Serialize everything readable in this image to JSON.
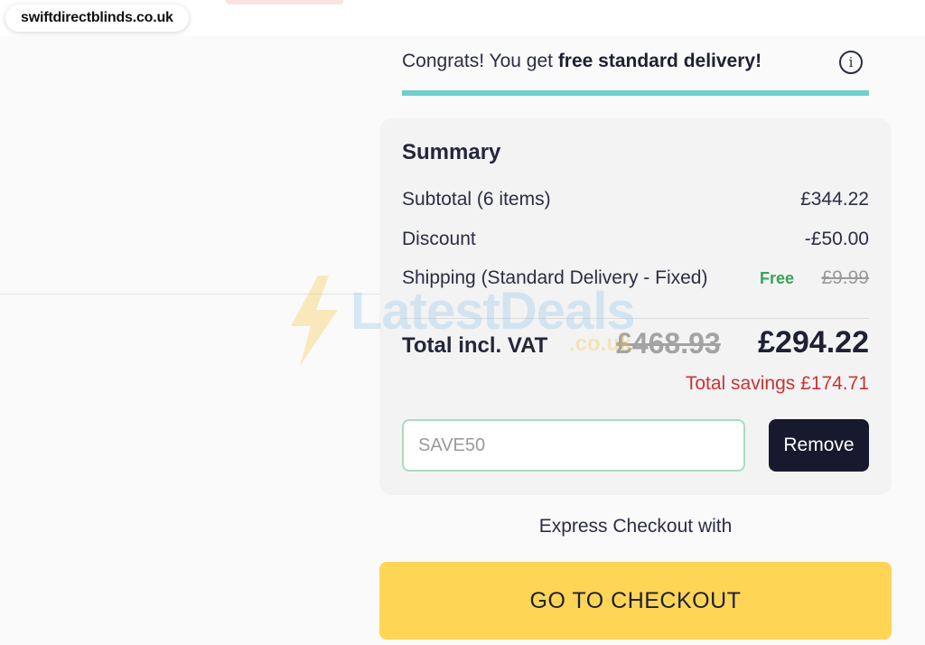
{
  "browser": {
    "url": "swiftdirectblinds.co.uk"
  },
  "delivery_banner": {
    "prefix": "Congrats! You get ",
    "highlight": "free standard delivery!",
    "progress_percent": 100,
    "progress_color": "#6fcfcb"
  },
  "summary": {
    "title": "Summary",
    "subtotal_label": "Subtotal (6 items)",
    "subtotal_value": "£344.22",
    "discount_label": "Discount",
    "discount_value": "-£50.00",
    "shipping_label": "Shipping (Standard Delivery - Fixed)",
    "shipping_free": "Free",
    "shipping_original": "£9.99",
    "total_label": "Total incl. VAT",
    "total_original": "£468.93",
    "total_value": "£294.22",
    "savings": "Total savings £174.71"
  },
  "promo": {
    "code": "SAVE50",
    "remove_label": "Remove"
  },
  "checkout": {
    "express_label": "Express Checkout with",
    "button_label": "GO TO CHECKOUT",
    "button_color": "#ffd556"
  },
  "watermark": {
    "brand": "LatestDeals",
    "suffix": ".co.uk"
  }
}
